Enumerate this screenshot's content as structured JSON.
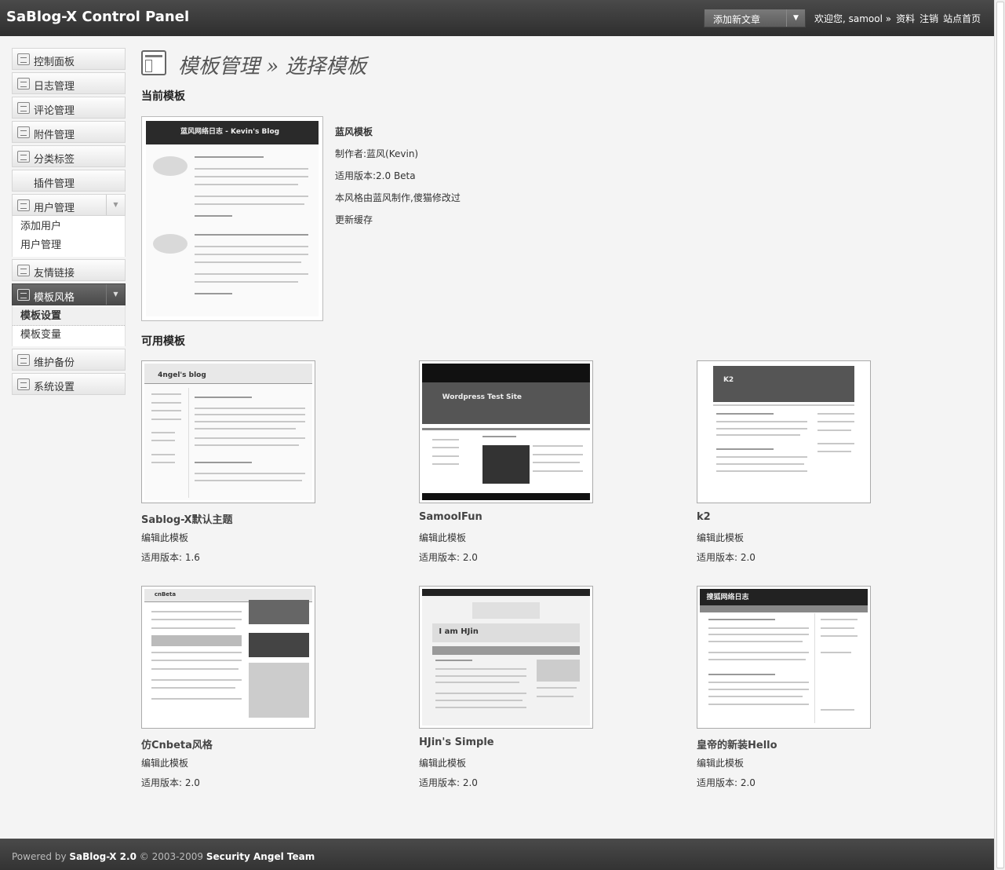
{
  "header": {
    "title": "SaBlog-X Control Panel",
    "quick_select": "添加新文章",
    "welcome": "欢迎您, samool »",
    "links": [
      "资料",
      "注销",
      "站点首页"
    ]
  },
  "sidebar": {
    "items": [
      {
        "label": "控制面板",
        "icon": "dashboard-icon"
      },
      {
        "label": "日志管理",
        "icon": "article-icon"
      },
      {
        "label": "评论管理",
        "icon": "comment-icon"
      },
      {
        "label": "附件管理",
        "icon": "attachment-icon"
      },
      {
        "label": "分类标签",
        "icon": "tag-icon"
      },
      {
        "label": "插件管理",
        "icon": ""
      },
      {
        "label": "用户管理",
        "icon": "users-icon"
      },
      {
        "label": "友情链接",
        "icon": "link-icon"
      },
      {
        "label": "模板风格",
        "icon": "template-icon"
      },
      {
        "label": "维护备份",
        "icon": "tools-icon"
      },
      {
        "label": "系统设置",
        "icon": "settings-icon"
      }
    ],
    "users_sub": [
      "添加用户",
      "用户管理"
    ],
    "template_sub": [
      "模板设置",
      "模板变量"
    ]
  },
  "page": {
    "title": "模板管理 » 选择模板",
    "current_section": "当前模板",
    "available_section": "可用模板"
  },
  "current": {
    "thumb_title": "蓝风网络日志 - Kevin's Blog",
    "name": "蓝风模板",
    "author": "制作者:蓝风(Kevin)",
    "version": "适用版本:2.0 Beta",
    "desc": "本风格由蓝风制作,傻猫修改过",
    "refresh": "更新缓存"
  },
  "templates": [
    {
      "name": "Sablog-X默认主题",
      "edit": "编辑此模板",
      "version": "适用版本: 1.6",
      "thumb_title": "4ngel's blog"
    },
    {
      "name": "SamoolFun",
      "edit": "编辑此模板",
      "version": "适用版本: 2.0",
      "thumb_title": "Wordpress Test Site"
    },
    {
      "name": "k2",
      "edit": "编辑此模板",
      "version": "适用版本: 2.0",
      "thumb_title": "K2"
    },
    {
      "name": "仿Cnbeta风格",
      "edit": "编辑此模板",
      "version": "适用版本: 2.0",
      "thumb_title": "cnBeta"
    },
    {
      "name": "HJin's Simple",
      "edit": "编辑此模板",
      "version": "适用版本: 2.0",
      "thumb_title": "I am HJin"
    },
    {
      "name": "皇帝的新装Hello",
      "edit": "编辑此模板",
      "version": "适用版本: 2.0",
      "thumb_title": "搜狐网络日志"
    }
  ],
  "footer": {
    "prefix": "Powered by",
    "product": "SaBlog-X 2.0",
    "middle": "© 2003-2009",
    "team": "Security Angel Team"
  }
}
